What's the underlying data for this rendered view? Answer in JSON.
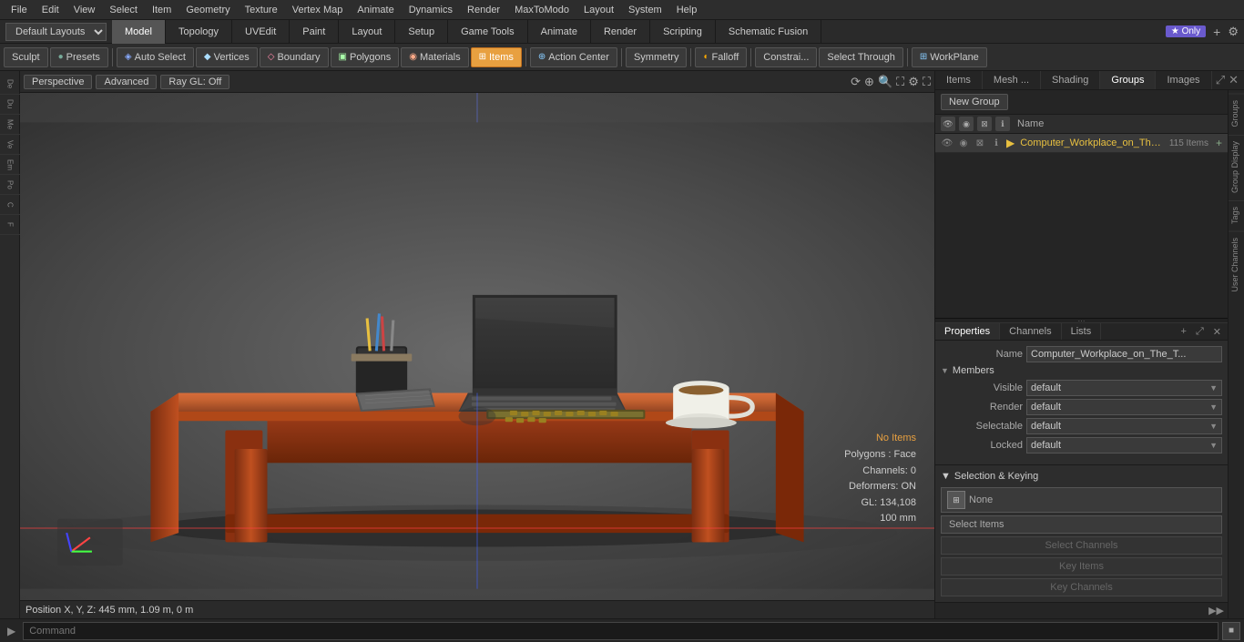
{
  "menu": {
    "items": [
      "File",
      "Edit",
      "View",
      "Select",
      "Item",
      "Geometry",
      "Texture",
      "Vertex Map",
      "Animate",
      "Dynamics",
      "Render",
      "MaxToModo",
      "Layout",
      "System",
      "Help"
    ]
  },
  "layout_bar": {
    "selector": "Default Layouts",
    "tabs": [
      "Model",
      "Topology",
      "UVEdit",
      "Paint",
      "Layout",
      "Setup",
      "Game Tools",
      "Animate",
      "Render",
      "Scripting",
      "Schematic Fusion"
    ],
    "active_tab": "Model",
    "star_label": "★ Only",
    "add_icon": "+",
    "gear_icon": "⚙"
  },
  "toolbar": {
    "sculpt": "Sculpt",
    "presets": "Presets",
    "auto_select": "Auto Select",
    "vertices": "Vertices",
    "boundary": "Boundary",
    "polygons": "Polygons",
    "materials": "Materials",
    "items": "Items",
    "action_center": "Action Center",
    "symmetry": "Symmetry",
    "falloff": "Falloff",
    "constraints": "Constrai...",
    "select_through": "Select Through",
    "workplane": "WorkPlane"
  },
  "viewport": {
    "perspective": "Perspective",
    "advanced": "Advanced",
    "ray_gl": "Ray GL: Off",
    "info": {
      "no_items": "No Items",
      "polygons": "Polygons : Face",
      "channels": "Channels: 0",
      "deformers": "Deformers: ON",
      "gl": "GL: 134,108",
      "size": "100 mm"
    }
  },
  "position_bar": {
    "label": "Position X, Y, Z:",
    "value": "445 mm, 1.09 m, 0 m"
  },
  "right_panel": {
    "tabs": [
      "Items",
      "Mesh ...",
      "Shading",
      "Groups",
      "Images"
    ],
    "active_tab": "Groups",
    "new_group_label": "New Group",
    "name_header": "Name",
    "item_name": "Computer_Workplace_on_The_...",
    "item_count": "115 Items"
  },
  "properties": {
    "tabs": [
      "Properties",
      "Channels",
      "Lists"
    ],
    "active_tab": "Properties",
    "name_label": "Name",
    "name_value": "Computer_Workplace_on_The_T...",
    "members_section": "Members",
    "visible_label": "Visible",
    "visible_value": "default",
    "render_label": "Render",
    "render_value": "default",
    "selectable_label": "Selectable",
    "selectable_value": "default",
    "locked_label": "Locked",
    "locked_value": "default",
    "selection_keying": "Selection & Keying",
    "none_label": "None",
    "select_items_label": "Select Items",
    "select_channels_label": "Select Channels",
    "key_items_label": "Key Items",
    "key_channels_label": "Key Channels",
    "add_tab_icon": "+"
  },
  "right_vtabs": [
    "Groups",
    "Group Display",
    "Tags",
    "User Channels"
  ],
  "command_bar": {
    "arrow": "▶",
    "placeholder": "Command",
    "btn_icon": "■"
  },
  "left_sidebar": {
    "items": [
      "De...",
      "Du...",
      "Me...",
      "Ve...",
      "Em...",
      "Po...",
      "C...",
      "F..."
    ]
  }
}
